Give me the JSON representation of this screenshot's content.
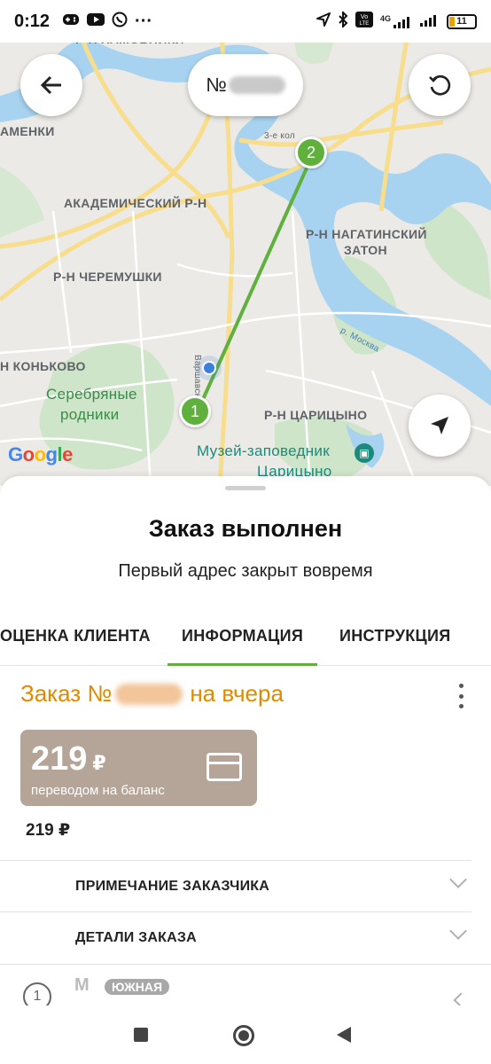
{
  "status_bar": {
    "time": "0:12",
    "more": "···",
    "net": "4G",
    "battery": "11"
  },
  "map": {
    "order_pill_prefix": "№",
    "labels": {
      "khamovniki": "Р-Н ХАМОВНИКИ",
      "ramenki": "АМЕНКИ",
      "akademichesky": "АКАДЕМИЧЕСКИЙ Р-Н",
      "nagatinsky_1": "Р-Н НАГАТИНСКИЙ",
      "nagatinsky_2": "ЗАТОН",
      "cheremushki": "Р-Н ЧЕРЕМУШКИ",
      "konkovo": "Н КОНЬКОВО",
      "serebryanye_1": "Серебряные",
      "serebryanye_2": "родники",
      "tsaritsyno": "Р-Н ЦАРИЦЫНО",
      "museum_1": "Музей-заповедник",
      "museum_2": "Царицыно",
      "ring_road": "3-е кол",
      "varshavskoe": "Варшавское ш.",
      "river": "р. Москва"
    },
    "marker_1": "1",
    "marker_2": "2",
    "google_logo": "Google"
  },
  "sheet": {
    "title": "Заказ выполнен",
    "subtitle": "Первый адрес закрыт вовремя",
    "tabs": [
      {
        "label": "ОЦЕНКА КЛИЕНТА"
      },
      {
        "label": "ИНФОРМАЦИЯ"
      },
      {
        "label": "ИНСТРУКЦИЯ"
      }
    ],
    "order_prefix": "Заказ №",
    "order_suffix": "на вчера",
    "payment": {
      "amount": "219",
      "currency": "₽",
      "method": "переводом на баланс"
    },
    "price_plain": "219 ₽",
    "sections": [
      {
        "label": "ПРИМЕЧАНИЕ ЗАКАЗЧИКА"
      },
      {
        "label": "ДЕТАЛИ ЗАКАЗА"
      }
    ],
    "stop": {
      "number": "1",
      "metro_icon": "М",
      "metro_station": "ЮЖНАЯ"
    }
  },
  "colors": {
    "accent_green": "#5fb03c",
    "order_orange": "#e08a00",
    "pay_card": "#b5a498"
  }
}
